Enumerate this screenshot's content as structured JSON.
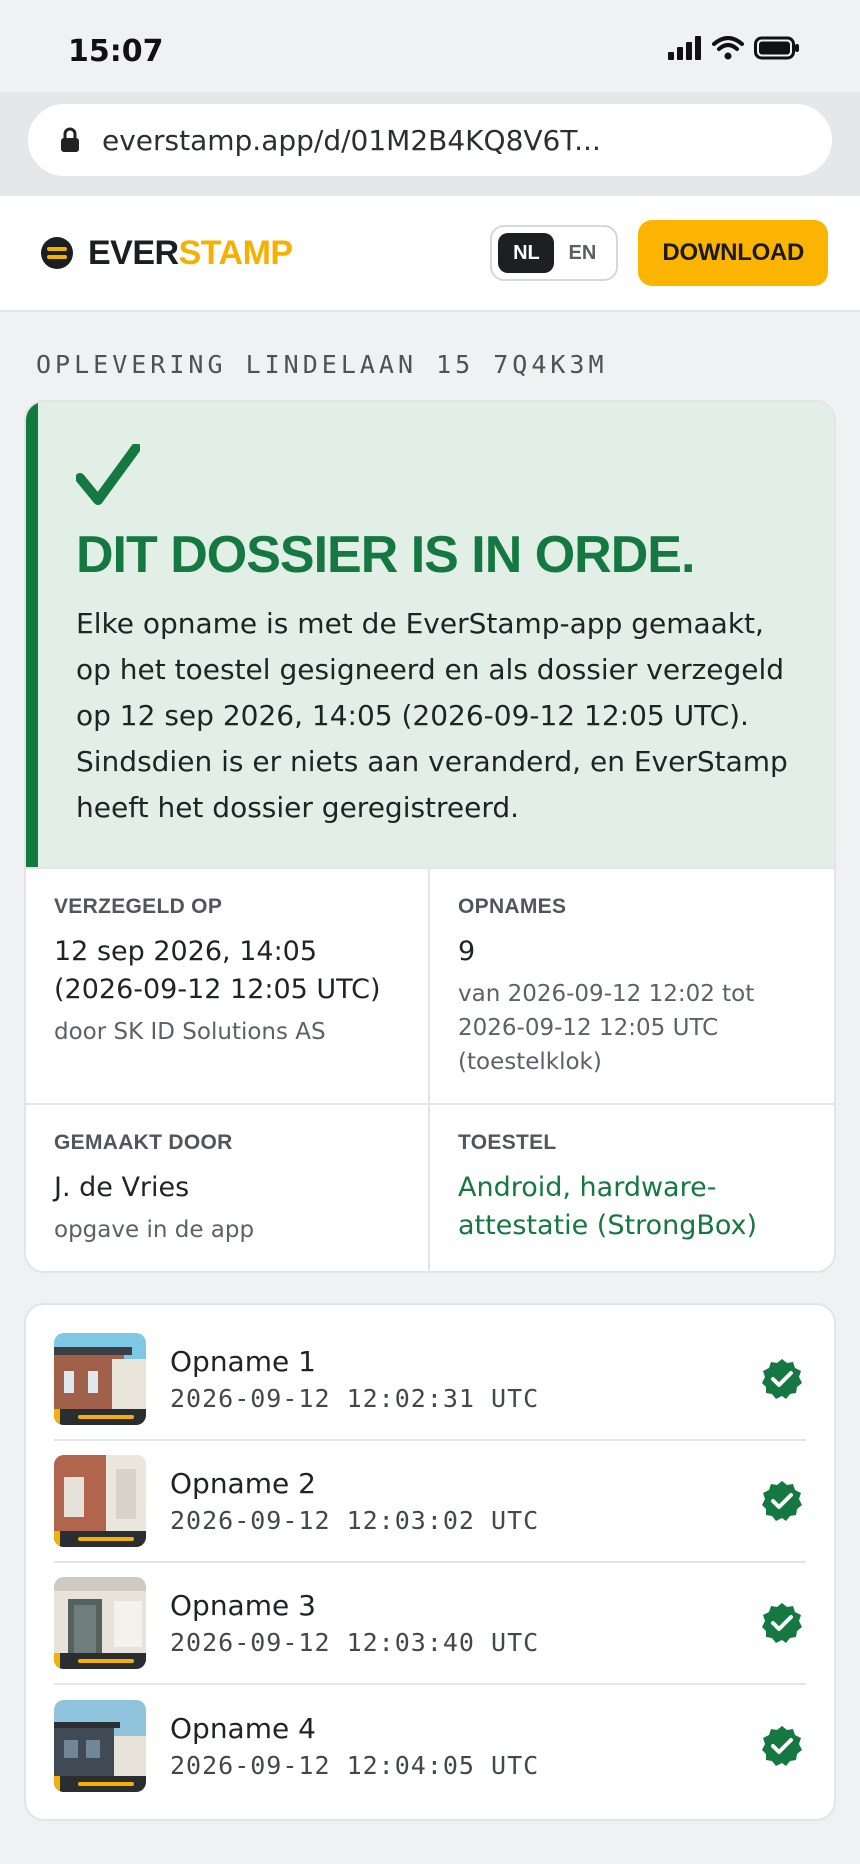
{
  "status_bar": {
    "time": "15:07"
  },
  "browser": {
    "url": "everstamp.app/d/01M2B4KQ8V6T..."
  },
  "header": {
    "logo_part1": "EVER",
    "logo_part2": "STAMP",
    "lang_options": [
      "NL",
      "EN"
    ],
    "lang_active": "NL",
    "download_label": "DOWNLOAD"
  },
  "dossier_title": "OPLEVERING LINDELAAN 15 7Q4K3M",
  "verdict": {
    "heading": "DIT DOSSIER IS IN ORDE.",
    "body": "Elke opname is met de EverStamp-app gemaakt, op het toestel gesigneerd en als dossier verzegeld op 12 sep 2026, 14:05 (2026-09-12 12:05 UTC). Sindsdien is er niets aan veranderd, en EverStamp heeft het dossier geregistreerd."
  },
  "details": {
    "sealed": {
      "label": "VERZEGELD OP",
      "value": "12 sep 2026, 14:05 (2026-09-12 12:05 UTC)",
      "note": "door SK ID Solutions AS"
    },
    "recordings": {
      "label": "OPNAMES",
      "value": "9",
      "note": "van 2026-09-12 12:02 tot 2026-09-12 12:05 UTC (toestelklok)"
    },
    "made_by": {
      "label": "GEMAAKT DOOR",
      "value": "J. de Vries",
      "note": "opgave in de app"
    },
    "device": {
      "label": "TOESTEL",
      "value": "Android, hardware-attestatie (StrongBox)"
    }
  },
  "recordings_list": [
    {
      "name": "Opname 1",
      "timestamp": "2026-09-12 12:02:31 UTC",
      "verified": true
    },
    {
      "name": "Opname 2",
      "timestamp": "2026-09-12 12:03:02 UTC",
      "verified": true
    },
    {
      "name": "Opname 3",
      "timestamp": "2026-09-12 12:03:40 UTC",
      "verified": true
    },
    {
      "name": "Opname 4",
      "timestamp": "2026-09-12 12:04:05 UTC",
      "verified": true
    }
  ],
  "colors": {
    "accent": "#fbb400",
    "ok_green": "#157841",
    "verdict_bg": "#e1efe6"
  }
}
